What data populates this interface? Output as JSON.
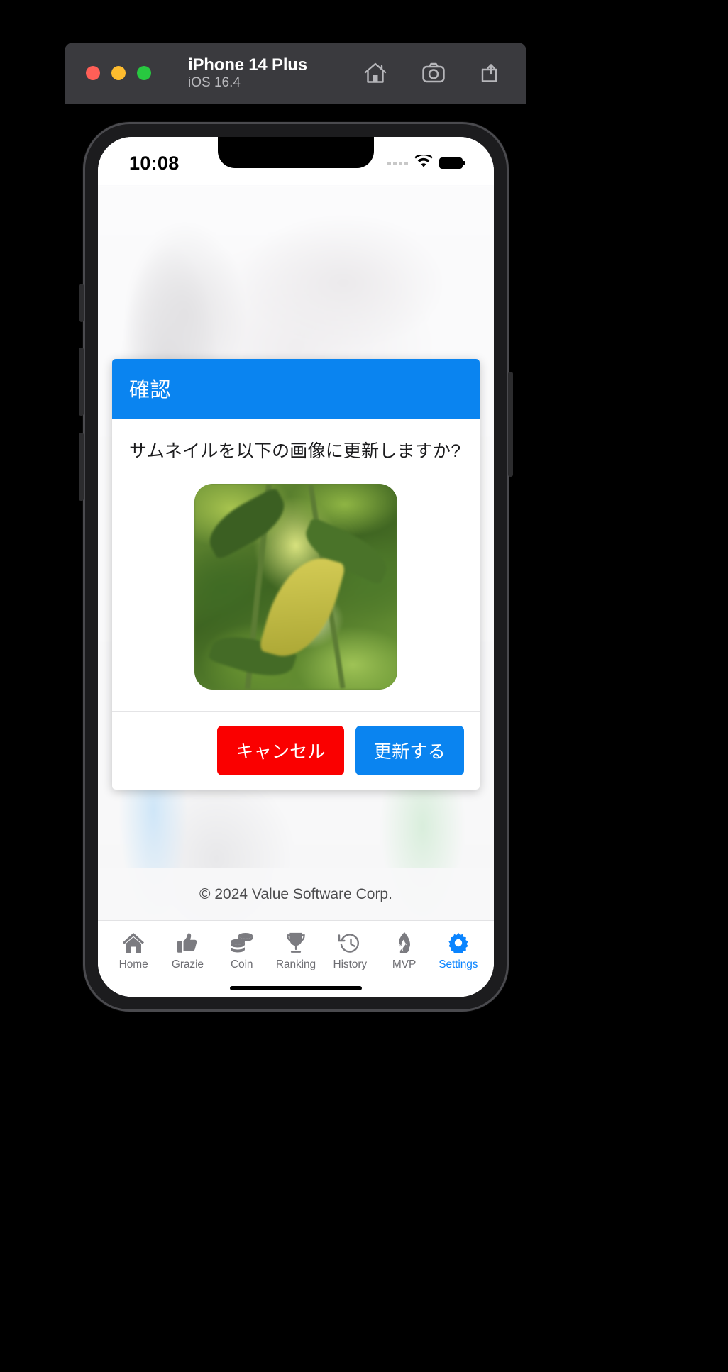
{
  "simulator": {
    "device_name": "iPhone 14 Plus",
    "os_version": "iOS 16.4",
    "window_controls": [
      {
        "name": "close",
        "color": "#ff5f57"
      },
      {
        "name": "minimize",
        "color": "#febc2e"
      },
      {
        "name": "zoom",
        "color": "#28c840"
      }
    ],
    "actions": [
      {
        "icon": "home-icon",
        "label": "Home"
      },
      {
        "icon": "screenshot-icon",
        "label": "Screenshot"
      },
      {
        "icon": "share-icon",
        "label": "Share"
      }
    ]
  },
  "status_bar": {
    "time": "10:08",
    "signal_icon": "cellular-dots-icon",
    "wifi_icon": "wifi-icon",
    "battery_icon": "battery-full-icon"
  },
  "dialog": {
    "title": "確認",
    "message": "サムネイルを以下の画像に更新しますか?",
    "thumbnail_alt": "green-leaves-photo",
    "buttons": [
      {
        "label": "キャンセル",
        "role": "cancel",
        "color": "#fa0000"
      },
      {
        "label": "更新する",
        "role": "confirm",
        "color": "#0a84f0"
      }
    ]
  },
  "footer": {
    "copyright": "© 2024 Value Software Corp."
  },
  "tabbar": {
    "active_color": "#0a84ff",
    "inactive_color": "#6e6e73",
    "items": [
      {
        "label": "Home",
        "icon": "house-icon",
        "active": false
      },
      {
        "label": "Grazie",
        "icon": "thumbs-up-icon",
        "active": false
      },
      {
        "label": "Coin",
        "icon": "coins-icon",
        "active": false
      },
      {
        "label": "Ranking",
        "icon": "trophy-icon",
        "active": false
      },
      {
        "label": "History",
        "icon": "clock-rotate-left-icon",
        "active": false
      },
      {
        "label": "MVP",
        "icon": "fire-icon",
        "active": false
      },
      {
        "label": "Settings",
        "icon": "gear-icon",
        "active": true
      }
    ]
  }
}
